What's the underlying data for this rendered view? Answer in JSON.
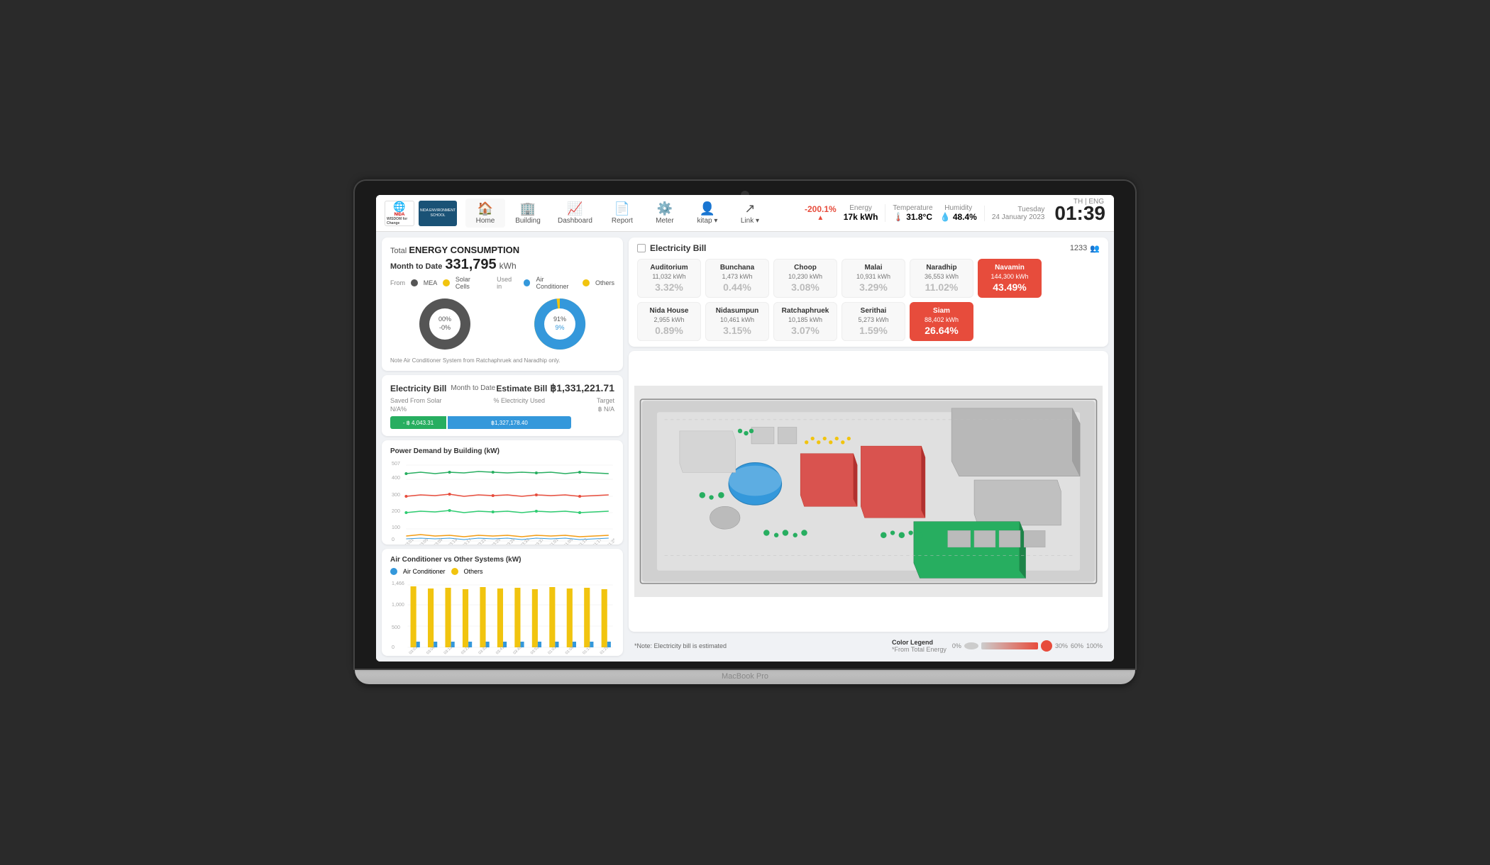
{
  "meta": {
    "lang": "TH | ENG",
    "time": "01:39",
    "day": "Tuesday",
    "date": "24 January 2023"
  },
  "navbar": {
    "logo_nida": "NIDA",
    "logo_sub": "WISDOM for Change",
    "logo_env": "NIDA ENVIRONMENT SCHOOL",
    "nav_items": [
      {
        "label": "Home",
        "icon": "🏠",
        "active": true
      },
      {
        "label": "Building",
        "icon": "🏢",
        "active": false
      },
      {
        "label": "Dashboard",
        "icon": "📈",
        "active": false
      },
      {
        "label": "Report",
        "icon": "📄",
        "active": false
      },
      {
        "label": "Meter",
        "icon": "⚙️",
        "active": false
      },
      {
        "label": "kitap ▾",
        "icon": "👤",
        "active": false
      },
      {
        "label": "Link ▾",
        "icon": "↗",
        "active": false
      }
    ],
    "energy_delta": "-200.1%",
    "energy_label": "Energy",
    "energy_value": "17k kWh",
    "temp_label": "Temperature",
    "temp_value": "31.8°C",
    "humidity_label": "Humidity",
    "humidity_value": "48.4%",
    "macbook_label": "MacBook Pro"
  },
  "energy_consumption": {
    "total_label": "Total",
    "title": "ENERGY CONSUMPTION",
    "month_label": "Month to Date",
    "total_value": "331,795",
    "unit": "kWh",
    "from_label": "From",
    "used_label": "Used in",
    "legend_mea": "MEA",
    "legend_solar": "Solar Cells",
    "legend_ac": "Air Conditioner",
    "legend_others": "Others",
    "pie1_label": "00% -0%",
    "pie2_label": "91%",
    "note": "Note  Air Conditioner System from Ratchaphruek and Naradhip only."
  },
  "electricity_bill": {
    "title": "Electricity Bill",
    "month_label": "Month to Date",
    "estimate_label": "Estimate Bill",
    "estimate_value": "฿1,331,221.71",
    "saved_label": "Saved From Solar",
    "pct_label": "% Electricity Used",
    "target_label": "Target",
    "saved_value": "- ฿ 4,043.31",
    "used_value": "฿1,327,178.40",
    "pct_value": "N/A%",
    "target_value": "฿ N/A"
  },
  "power_demand": {
    "title": "Power Demand by Building (kW)",
    "y_max": 507,
    "y_values": [
      507,
      400,
      300,
      200,
      100,
      0
    ]
  },
  "ac_chart": {
    "title": "Air Conditioner vs Other Systems (kW)",
    "legend_ac": "Air Conditioner",
    "legend_others": "Others",
    "y_max": 1466,
    "y_values": [
      1466,
      1000,
      500,
      0
    ]
  },
  "elec_bill_panel": {
    "title": "Electricity Bill",
    "checkbox": false,
    "user_count": "1233",
    "buildings": [
      {
        "name": "Auditorium",
        "kwh": "11,032 kWh",
        "pct": "3.32%",
        "highlight": false
      },
      {
        "name": "Bunchana",
        "kwh": "1,473 kWh",
        "pct": "0.44%",
        "highlight": false
      },
      {
        "name": "Choop",
        "kwh": "10,230 kWh",
        "pct": "3.08%",
        "highlight": false
      },
      {
        "name": "Malai",
        "kwh": "10,931 kWh",
        "pct": "3.29%",
        "highlight": false
      },
      {
        "name": "Naradhip",
        "kwh": "36,553 kWh",
        "pct": "11.02%",
        "highlight": false
      },
      {
        "name": "Navamin",
        "kwh": "144,300 kWh",
        "pct": "43.49%",
        "highlight": true
      },
      {
        "name": "Nida House",
        "kwh": "2,955 kWh",
        "pct": "0.89%",
        "highlight": false
      },
      {
        "name": "Nidasumpun",
        "kwh": "10,461 kWh",
        "pct": "3.15%",
        "highlight": false
      },
      {
        "name": "Ratchaphruek",
        "kwh": "10,185 kWh",
        "pct": "3.07%",
        "highlight": false
      },
      {
        "name": "Serithai",
        "kwh": "5,273 kWh",
        "pct": "1.59%",
        "highlight": false
      },
      {
        "name": "Siam",
        "kwh": "88,402 kWh",
        "pct": "26.64%",
        "highlight": true
      }
    ]
  },
  "color_legend": {
    "title": "Color Legend",
    "subtitle": "*From Total Energy",
    "labels": [
      "0%",
      "30%",
      "60%",
      "100%"
    ]
  },
  "map_footer": {
    "note": "*Note: Electricity bill is estimated"
  }
}
